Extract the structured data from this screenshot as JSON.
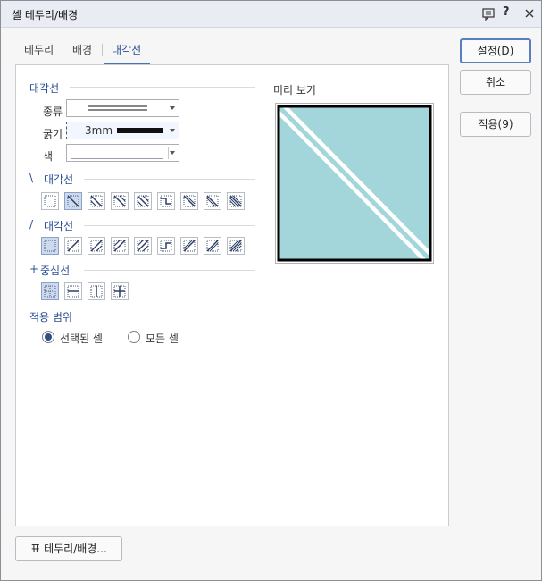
{
  "window": {
    "title": "셀 테두리/배경"
  },
  "titlebar_icons": [
    "comment-icon",
    "help-icon",
    "close-icon"
  ],
  "titlebar_help_glyph": "?",
  "tabs": [
    {
      "label": "테두리"
    },
    {
      "label": "배경"
    },
    {
      "label": "대각선",
      "active": true
    }
  ],
  "diagonal_section": {
    "title": "대각선",
    "type_label": "종류",
    "thickness_label": "굵기",
    "thickness_value": "3mm",
    "color_label": "색",
    "color_value": "#ffffff"
  },
  "backslash_section": {
    "title": "대각선",
    "prefix": "\\"
  },
  "slash_section": {
    "title": "대각선",
    "prefix": "/"
  },
  "center_section": {
    "title": "중심선",
    "prefix": "+"
  },
  "apply_range": {
    "title": "적용 범위",
    "options": [
      {
        "label": "선택된 셀",
        "checked": true
      },
      {
        "label": "모든 셀",
        "checked": false
      }
    ]
  },
  "preview": {
    "title": "미리 보기",
    "fill_color": "#a2d6db"
  },
  "buttons": {
    "ok": "설정(D)",
    "cancel": "취소",
    "apply": "적용(9)",
    "table_border": "표 테두리/배경..."
  },
  "selected": {
    "backslash_index": 1,
    "slash_index": 0,
    "center_index": 0
  }
}
